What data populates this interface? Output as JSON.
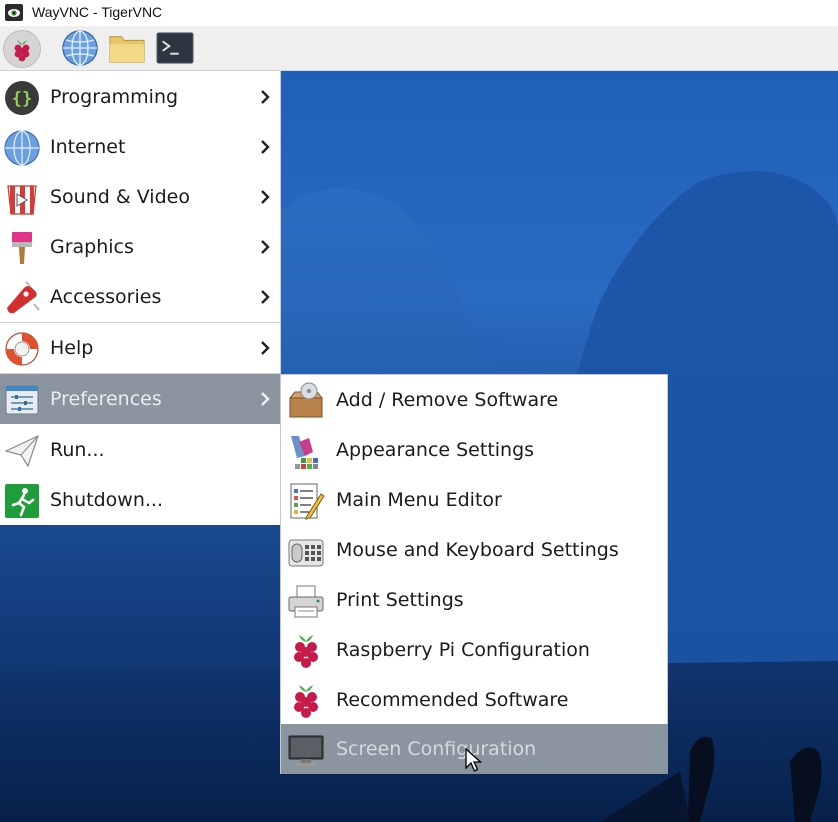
{
  "window": {
    "title": "WayVNC - TigerVNC"
  },
  "panel": {
    "launchers": [
      {
        "icon": "raspberry-icon",
        "name": "menu"
      },
      {
        "icon": "globe-icon",
        "name": "browser"
      },
      {
        "icon": "folder-icon",
        "name": "file-manager"
      },
      {
        "icon": "terminal-icon",
        "name": "terminal"
      }
    ]
  },
  "main_menu": {
    "items": [
      {
        "label": "Programming",
        "icon": "programming-icon",
        "has_submenu": true
      },
      {
        "label": "Internet",
        "icon": "globe-icon",
        "has_submenu": true
      },
      {
        "label": "Sound & Video",
        "icon": "sound-video-icon",
        "has_submenu": true
      },
      {
        "label": "Graphics",
        "icon": "paintbrush-icon",
        "has_submenu": true
      },
      {
        "label": "Accessories",
        "icon": "accessories-icon",
        "has_submenu": true
      },
      {
        "label": "Help",
        "icon": "lifebuoy-icon",
        "has_submenu": true
      },
      {
        "label": "Preferences",
        "icon": "preferences-icon",
        "has_submenu": true,
        "selected": true
      },
      {
        "label": "Run...",
        "icon": "paper-plane-icon",
        "has_submenu": false
      },
      {
        "label": "Shutdown...",
        "icon": "exit-icon",
        "has_submenu": false
      }
    ]
  },
  "preferences_menu": {
    "items": [
      {
        "label": "Add / Remove Software",
        "icon": "package-icon"
      },
      {
        "label": "Appearance Settings",
        "icon": "appearance-icon"
      },
      {
        "label": "Main Menu Editor",
        "icon": "menu-editor-icon"
      },
      {
        "label": "Mouse and Keyboard Settings",
        "icon": "mouse-keyboard-icon"
      },
      {
        "label": "Print Settings",
        "icon": "printer-icon"
      },
      {
        "label": "Raspberry Pi Configuration",
        "icon": "raspberry-icon"
      },
      {
        "label": "Recommended Software",
        "icon": "raspberry-icon"
      },
      {
        "label": "Screen Configuration",
        "icon": "monitor-icon",
        "selected": true
      }
    ]
  },
  "colors": {
    "selected_bg": "#8b959f",
    "menu_bg": "#ffffff",
    "desktop_sky": "#2a6bc2"
  }
}
